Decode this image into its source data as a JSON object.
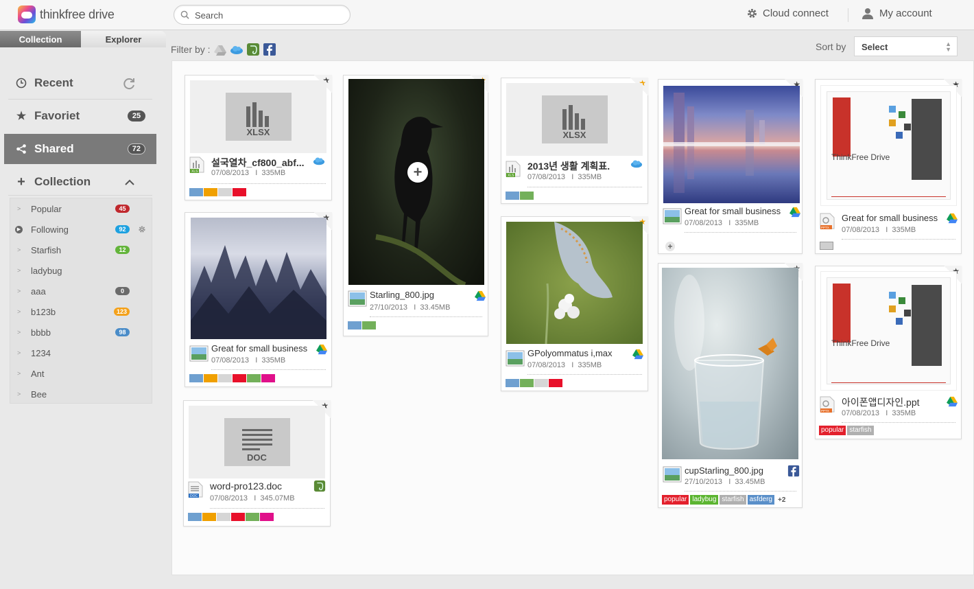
{
  "app": {
    "brand": "thinkfree drive"
  },
  "header": {
    "search_placeholder": "Search",
    "cloud_connect": "Cloud connect",
    "my_account": "My account"
  },
  "tabs": {
    "collection": "Collection",
    "explorer": "Explorer"
  },
  "toolbar": {
    "filter_label": "Filter by :",
    "sort_label": "Sort by",
    "sort_value": "Select"
  },
  "sidebar": {
    "recent": "Recent",
    "favorite": "Favoriet",
    "favorite_count": "25",
    "shared": "Shared",
    "shared_count": "72",
    "collection": "Collection",
    "items": [
      {
        "label": "Popular",
        "count": "45",
        "color": "#c0282d"
      },
      {
        "label": "Following",
        "count": "92",
        "color": "#1ea1e0"
      },
      {
        "label": "Starfish",
        "count": "12",
        "color": "#63b43a"
      },
      {
        "label": "ladybug",
        "count": "",
        "color": ""
      },
      {
        "label": "aaa",
        "count": "0",
        "color": "#6b6b6b"
      },
      {
        "label": "b123b",
        "count": "123",
        "color": "#f4a11a"
      },
      {
        "label": "bbbb",
        "count": "98",
        "color": "#4a8cc8"
      },
      {
        "label": "1234",
        "count": "",
        "color": ""
      },
      {
        "label": "Ant",
        "count": "",
        "color": ""
      },
      {
        "label": "Bee",
        "count": "",
        "color": ""
      }
    ]
  },
  "files": [
    {
      "name": "설국열차_cf800_abf...",
      "date": "07/08/2013",
      "size": "335MB",
      "thumb_label": "XLSX",
      "type": "XLS"
    },
    {
      "name": "Great for small business",
      "date": "07/08/2013",
      "size": "335MB"
    },
    {
      "name": "word-pro123.doc",
      "date": "07/08/2013",
      "size": "345.07MB",
      "thumb_label": "DOC",
      "type": "DOC"
    },
    {
      "name": "Starling_800.jpg",
      "date": "27/10/2013",
      "size": "33.45MB"
    },
    {
      "name": "2013년 생활 계획표.",
      "date": "07/08/2013",
      "size": "335MB",
      "thumb_label": "XLSX",
      "type": "XLS"
    },
    {
      "name": "GPolyommatus i,max",
      "date": "07/08/2013",
      "size": "335MB"
    },
    {
      "name": "Great for small business",
      "date": "07/08/2013",
      "size": "335MB"
    },
    {
      "name": "cupStarling_800.jpg",
      "date": "27/10/2013",
      "size": "33.45MB",
      "tags": [
        "popular",
        "ladybug",
        "starfish",
        "asfderg"
      ],
      "more": "+2"
    },
    {
      "name": "Great for small business",
      "date": "07/08/2013",
      "size": "335MB",
      "type": "PPTX",
      "slide_title": "ThinkFree Drive"
    },
    {
      "name": "아이폰앱디자인.ppt",
      "date": "07/08/2013",
      "size": "335MB",
      "type": "PPTX",
      "slide_title": "ThinkFree Drive",
      "tags": [
        "popular",
        "starfish"
      ]
    }
  ],
  "colors": {
    "accent_gray": "#7a7a7a",
    "tag_popular": "#e3202c",
    "tag_ladybug": "#5cb531",
    "tag_starfish": "#b0b0b0",
    "tag_asfderg": "#5a8fc9"
  }
}
